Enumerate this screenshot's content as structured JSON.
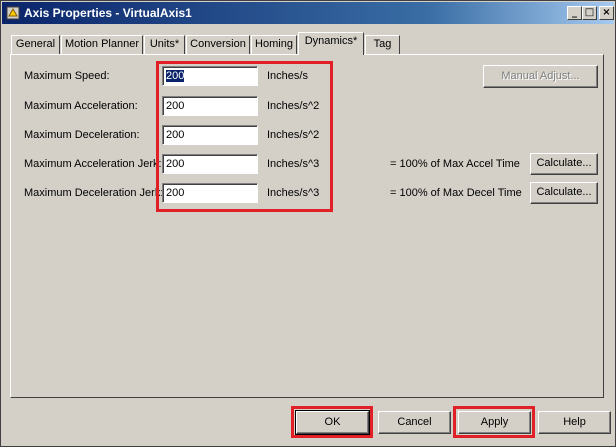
{
  "window": {
    "title": "Axis Properties - VirtualAxis1",
    "controls": {
      "minimize": "_",
      "maximize": "□",
      "close": "×"
    }
  },
  "tabs": [
    {
      "label": "General"
    },
    {
      "label": "Motion Planner"
    },
    {
      "label": "Units*"
    },
    {
      "label": "Conversion"
    },
    {
      "label": "Homing"
    },
    {
      "label": "Dynamics*"
    },
    {
      "label": "Tag"
    }
  ],
  "active_tab": "Dynamics*",
  "dynamics": {
    "fields": [
      {
        "label": "Maximum Speed:",
        "value": "200",
        "unit": "Inches/s"
      },
      {
        "label": "Maximum Acceleration:",
        "value": "200",
        "unit": "Inches/s^2"
      },
      {
        "label": "Maximum Deceleration:",
        "value": "200",
        "unit": "Inches/s^2"
      },
      {
        "label": "Maximum Acceleration Jerk:",
        "value": "200",
        "unit": "Inches/s^3",
        "note": "= 100% of Max Accel Time",
        "button": "Calculate..."
      },
      {
        "label": "Maximum Deceleration Jerk:",
        "value": "200",
        "unit": "Inches/s^3",
        "note": "= 100% of Max Decel Time",
        "button": "Calculate..."
      }
    ],
    "manual_adjust_label": "Manual Adjust..."
  },
  "footer": {
    "ok": "OK",
    "cancel": "Cancel",
    "apply": "Apply",
    "help": "Help"
  },
  "colors": {
    "highlight": "#e01f26",
    "titlebar": "#0a246a",
    "face": "#d4d0c8"
  },
  "icons": {
    "app": "axis-properties-icon"
  }
}
